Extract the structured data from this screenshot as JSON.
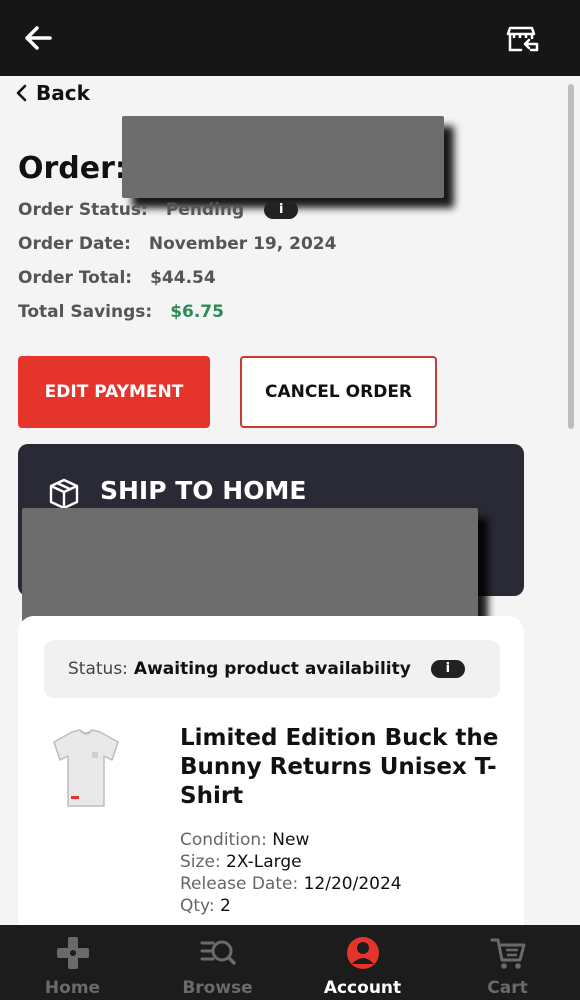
{
  "header": {
    "back_icon": "arrow-left-icon",
    "store_icon": "store-return-icon"
  },
  "nav": {
    "back_label": "Back"
  },
  "order": {
    "title": "Order:",
    "status_label": "Order Status:",
    "status_value": "Pending",
    "date_label": "Order Date:",
    "date_value": "November 19, 2024",
    "total_label": "Order Total:",
    "total_value": "$44.54",
    "savings_label": "Total Savings:",
    "savings_value": "$6.75",
    "info_glyph": "i"
  },
  "actions": {
    "edit_payment": "EDIT PAYMENT",
    "cancel_order": "CANCEL ORDER"
  },
  "shipping": {
    "title": "SHIP TO HOME",
    "icon": "package-icon"
  },
  "item": {
    "status_label": "Status:",
    "status_value": "Awaiting product availability",
    "name": "Limited Edition Buck the Bunny Returns Unisex T-Shirt",
    "condition_label": "Condition:",
    "condition_value": "New",
    "size_label": "Size:",
    "size_value": "2X-Large",
    "release_label": "Release Date:",
    "release_value": "12/20/2024",
    "qty_label": "Qty:",
    "qty_value": "2"
  },
  "bottom_nav": [
    {
      "label": "Home",
      "icon": "gamepad-icon",
      "active": false
    },
    {
      "label": "Browse",
      "icon": "browse-search-icon",
      "active": false
    },
    {
      "label": "Account",
      "icon": "account-icon",
      "active": true
    },
    {
      "label": "Cart",
      "icon": "cart-icon",
      "active": false
    }
  ],
  "colors": {
    "accent": "#e5342b",
    "savings": "#2e8b57",
    "dark_card": "#2a2a36",
    "bar": "#161616"
  }
}
